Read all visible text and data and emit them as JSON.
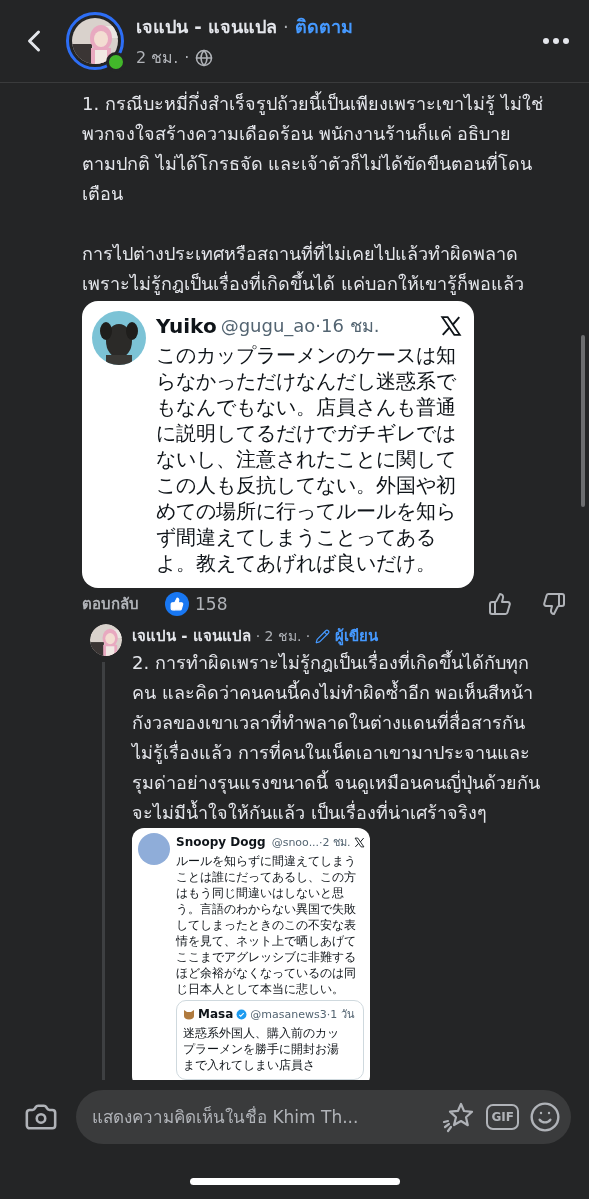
{
  "header": {
    "author": "เจแปน - แจนแปล",
    "separator": "·",
    "follow": "ติดตาม",
    "time": "2 ชม.",
    "time_separator": "·"
  },
  "comment": {
    "paragraphs": [
      "1. กรณีบะหมี่กึ่งสำเร็จรูปถ้วยนี้เป็นเพียงเพราะเขาไม่รู้ ไม่ใช่\nพวกจงใจสร้างความเดือดร้อน พนักงานร้านก็แค่ อธิบาย\nตามปกติ ไม่ได้โกรธจัด และเจ้าตัวก็ไม่ได้ขัดขืนตอนที่โดน\nเตือน",
      "การไปต่างประเทศหรือสถานที่ที่ไม่เคยไปแล้วทำผิดพลาด\nเพราะไม่รู้กฎเป็นเรื่องที่เกิดขึ้นได้ แค่บอกให้เขารู้ก็พอแล้ว"
    ],
    "embed": {
      "name": "Yuiko",
      "handle_time": "@gugu_ao·16 ชม.",
      "text": "このカップラーメンのケースは知らなかっただけなんだし迷惑系でもなんでもない。店員さんも普通に説明してるだけでガチギレではないし、注意されたことに関してこの人も反抗してない。外国や初めての場所に行ってルールを知らず間違えてしまうことってあるよ。教えてあげれば良いだけ。"
    },
    "reply_label": "ตอบกลับ",
    "like_count": "158"
  },
  "reply": {
    "author": "เจแปน - แจนแปล",
    "time": "· 2 ชม. ·",
    "badge": "ผู้เขียน",
    "text": "2. การทำผิดเพราะไม่รู้กฎเป็นเรื่องที่เกิดขึ้นได้กับทุก\nคน และคิดว่าคนคนนี้คงไม่ทำผิดซ้ำอีก พอเห็นสีหน้า\nกังวลของเขาเวลาที่ทำพลาดในต่างแดนที่สื่อสารกัน\nไม่รู้เรื่องแล้ว การที่คนในเน็ตเอาเขามาประจานและ\nรุมด่าอย่างรุนแรงขนาดนี้ จนดูเหมือนคนญี่ปุ่นด้วยกัน\nจะไม่มีน้ำใจให้กันแล้ว เป็นเรื่องที่น่าเศร้าจริงๆ",
    "embed": {
      "name": "Snoopy Dogg",
      "handle_time": "@snoo...·2 ชม.",
      "text": "ルールを知らずに間違えてしまうことは誰にだってあるし、この方はもう同じ間違いはしないと思う。言語のわからない異国で失敗してしまったときのこの不安な表情を見て、ネット上で晒しあげてここまでアグレッシブに非難するほど余裕がなくなっているのは同じ日本人として本当に悲しい。",
      "quote": {
        "name": "Masa",
        "handle_time": "@masanews3·1 วัน",
        "text": "迷惑系外国人、購入前のカップラーメンを勝手に開封お湯まで入れてしまい店員さ"
      }
    }
  },
  "composer": {
    "placeholder": "แสดงความคิดเห็นในชื่อ Khim Th...",
    "gif_label": "GIF"
  }
}
